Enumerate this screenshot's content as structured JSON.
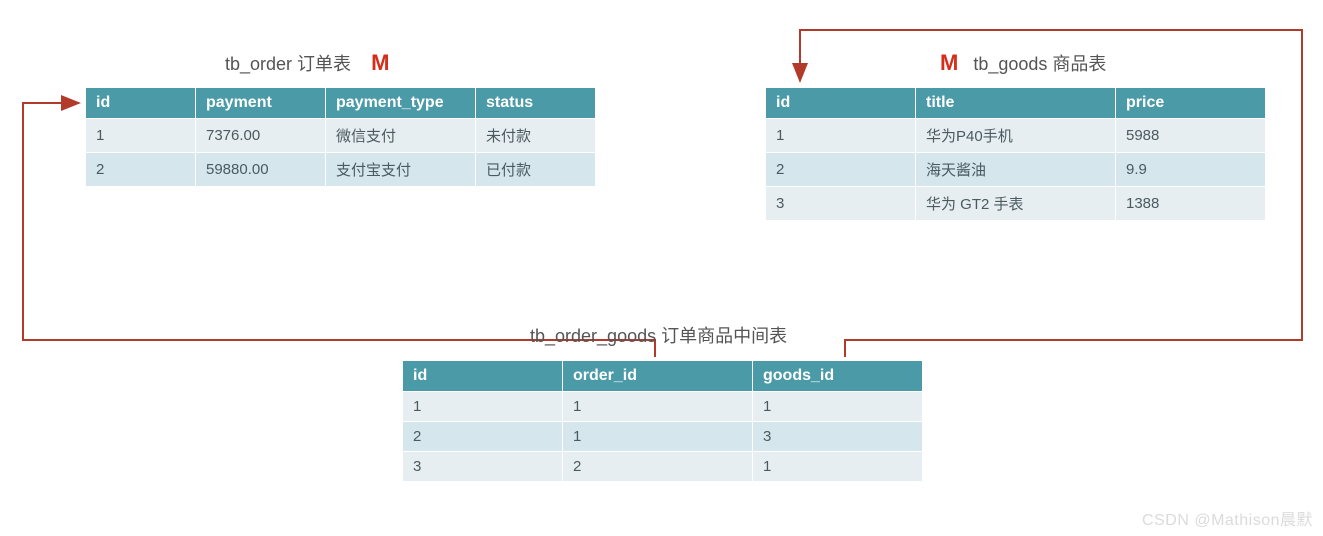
{
  "order_table": {
    "title": "tb_order 订单表",
    "marker": "M",
    "headers": [
      "id",
      "payment",
      "payment_type",
      "status"
    ],
    "rows": [
      [
        "1",
        "7376.00",
        "微信支付",
        "未付款"
      ],
      [
        "2",
        "59880.00",
        "支付宝支付",
        "已付款"
      ]
    ]
  },
  "goods_table": {
    "marker": "M",
    "title": "tb_goods 商品表",
    "headers": [
      "id",
      "title",
      "price"
    ],
    "rows": [
      [
        "1",
        "华为P40手机",
        "5988"
      ],
      [
        "2",
        "海天酱油",
        "9.9"
      ],
      [
        "3",
        "华为 GT2 手表",
        "1388"
      ]
    ]
  },
  "join_table": {
    "title": "tb_order_goods 订单商品中间表",
    "headers": [
      "id",
      "order_id",
      "goods_id"
    ],
    "rows": [
      [
        "1",
        "1",
        "1"
      ],
      [
        "2",
        "1",
        "3"
      ],
      [
        "3",
        "2",
        "1"
      ]
    ]
  },
  "watermark": "CSDN @Mathison晨默",
  "colors": {
    "arrow": "#b23a2a",
    "header_bg": "#4a9aa8"
  }
}
